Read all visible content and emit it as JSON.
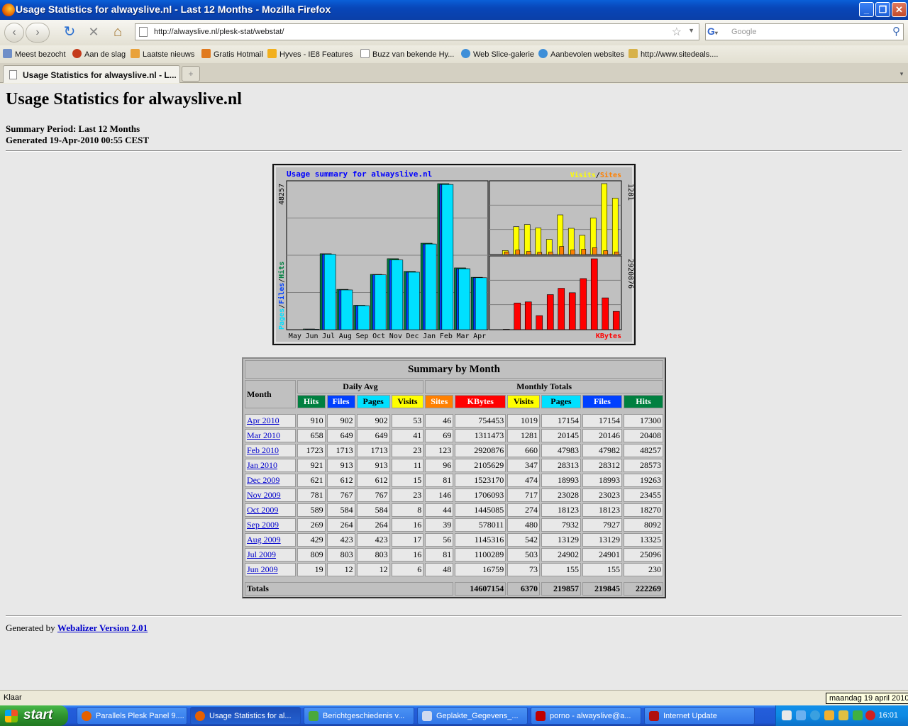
{
  "window": {
    "title": "Usage Statistics for alwayslive.nl - Last 12 Months - Mozilla Firefox",
    "min": "_",
    "max": "❐",
    "close": "✕"
  },
  "nav": {
    "url": "http://alwayslive.nl/plesk-stat/webstat/",
    "search_placeholder": "Google",
    "back": "‹",
    "forward": "›",
    "reload": "↻",
    "stop": "✕",
    "home": "⌂"
  },
  "bookmarks": [
    {
      "label": "Meest bezocht",
      "icon": "folder-icon",
      "color": "#6f8fc8"
    },
    {
      "label": "Aan de slag",
      "icon": "firefox-icon",
      "color": "#c43b1c"
    },
    {
      "label": "Laatste nieuws",
      "icon": "rss-icon",
      "color": "#e9a23a"
    },
    {
      "label": "Gratis Hotmail",
      "icon": "msn-icon",
      "color": "#e07a1f"
    },
    {
      "label": "Hyves - IE8 Features",
      "icon": "hyves-icon",
      "color": "#f2b01e"
    },
    {
      "label": "Buzz van bekende Hy...",
      "icon": "page-icon",
      "color": "#ffffff"
    },
    {
      "label": "Web Slice-galerie",
      "icon": "ie-icon",
      "color": "#3e8fd8"
    },
    {
      "label": "Aanbevolen websites",
      "icon": "ie-icon",
      "color": "#3e8fd8"
    },
    {
      "label": "http://www.sitedeals....",
      "icon": "sd-icon",
      "color": "#d7b24a"
    }
  ],
  "tab": {
    "label": "Usage Statistics for alwayslive.nl - L...",
    "new_tab": "+",
    "list": "▾"
  },
  "page": {
    "title": "Usage Statistics for alwayslive.nl",
    "summary_period": "Summary Period: Last 12 Months",
    "generated": "Generated 19-Apr-2010 00:55 CEST",
    "footer_prefix": "Generated by ",
    "footer_link": "Webalizer Version 2.01"
  },
  "chart_data": {
    "type": "bar",
    "title": "Usage summary for alwayslive.nl",
    "categories": [
      "May",
      "Jun",
      "Jul",
      "Aug",
      "Sep",
      "Oct",
      "Nov",
      "Dec",
      "Jan",
      "Feb",
      "Mar",
      "Apr"
    ],
    "left_panel": {
      "max_label": "48257",
      "ylabel_parts": [
        "Pages",
        "Files",
        "Hits"
      ],
      "series": [
        {
          "name": "Hits",
          "color": "#008040",
          "values": [
            0,
            230,
            25096,
            13325,
            8092,
            18270,
            23455,
            19263,
            28573,
            48257,
            20408,
            17300
          ]
        },
        {
          "name": "Files",
          "color": "#0040ff",
          "values": [
            0,
            155,
            24901,
            13129,
            7927,
            18123,
            23023,
            18993,
            28312,
            47982,
            20146,
            17154
          ]
        },
        {
          "name": "Pages",
          "color": "#00e0ff",
          "values": [
            0,
            155,
            24902,
            13129,
            7932,
            18123,
            23028,
            18993,
            28313,
            47983,
            20145,
            17154
          ]
        }
      ]
    },
    "top_right_panel": {
      "max_label": "1281",
      "legend_parts": [
        "Visits",
        "Sites"
      ],
      "series": [
        {
          "name": "Visits",
          "color": "#ffff00",
          "values": [
            0,
            73,
            503,
            542,
            480,
            274,
            717,
            474,
            347,
            660,
            1281,
            1019
          ]
        },
        {
          "name": "Sites",
          "color": "#ff8000",
          "values": [
            0,
            48,
            81,
            56,
            39,
            44,
            146,
            81,
            96,
            123,
            69,
            46
          ]
        }
      ]
    },
    "bottom_right_panel": {
      "max_label": "2920876",
      "legend": "KBytes",
      "series": [
        {
          "name": "KBytes",
          "color": "#ff0000",
          "values": [
            0,
            16759,
            1100289,
            1145316,
            578011,
            1445085,
            1706093,
            1523170,
            2105629,
            2920876,
            1311473,
            754453
          ]
        }
      ]
    }
  },
  "table": {
    "caption": "Summary by Month",
    "month_header": "Month",
    "daily_avg_header": "Daily Avg",
    "monthly_totals_header": "Monthly Totals",
    "columns": [
      {
        "label": "Hits",
        "color": "#008040",
        "text": "#ffffff"
      },
      {
        "label": "Files",
        "color": "#0040ff",
        "text": "#ffffff"
      },
      {
        "label": "Pages",
        "color": "#00e0ff",
        "text": "#000000"
      },
      {
        "label": "Visits",
        "color": "#ffff00",
        "text": "#000000"
      },
      {
        "label": "Sites",
        "color": "#ff8000",
        "text": "#ffffff"
      },
      {
        "label": "KBytes",
        "color": "#ff0000",
        "text": "#ffffff"
      },
      {
        "label": "Visits",
        "color": "#ffff00",
        "text": "#000000"
      },
      {
        "label": "Pages",
        "color": "#00e0ff",
        "text": "#000000"
      },
      {
        "label": "Files",
        "color": "#0040ff",
        "text": "#ffffff"
      },
      {
        "label": "Hits",
        "color": "#008040",
        "text": "#ffffff"
      }
    ],
    "rows": [
      [
        "Apr 2010",
        "910",
        "902",
        "902",
        "53",
        "46",
        "754453",
        "1019",
        "17154",
        "17154",
        "17300"
      ],
      [
        "Mar 2010",
        "658",
        "649",
        "649",
        "41",
        "69",
        "1311473",
        "1281",
        "20145",
        "20146",
        "20408"
      ],
      [
        "Feb 2010",
        "1723",
        "1713",
        "1713",
        "23",
        "123",
        "2920876",
        "660",
        "47983",
        "47982",
        "48257"
      ],
      [
        "Jan 2010",
        "921",
        "913",
        "913",
        "11",
        "96",
        "2105629",
        "347",
        "28313",
        "28312",
        "28573"
      ],
      [
        "Dec 2009",
        "621",
        "612",
        "612",
        "15",
        "81",
        "1523170",
        "474",
        "18993",
        "18993",
        "19263"
      ],
      [
        "Nov 2009",
        "781",
        "767",
        "767",
        "23",
        "146",
        "1706093",
        "717",
        "23028",
        "23023",
        "23455"
      ],
      [
        "Oct 2009",
        "589",
        "584",
        "584",
        "8",
        "44",
        "1445085",
        "274",
        "18123",
        "18123",
        "18270"
      ],
      [
        "Sep 2009",
        "269",
        "264",
        "264",
        "16",
        "39",
        "578011",
        "480",
        "7932",
        "7927",
        "8092"
      ],
      [
        "Aug 2009",
        "429",
        "423",
        "423",
        "17",
        "56",
        "1145316",
        "542",
        "13129",
        "13129",
        "13325"
      ],
      [
        "Jul 2009",
        "809",
        "803",
        "803",
        "16",
        "81",
        "1100289",
        "503",
        "24902",
        "24901",
        "25096"
      ],
      [
        "Jun 2009",
        "19",
        "12",
        "12",
        "6",
        "48",
        "16759",
        "73",
        "155",
        "155",
        "230"
      ]
    ],
    "totals": {
      "label": "Totals",
      "values": [
        "14607154",
        "6370",
        "219857",
        "219845",
        "222269"
      ]
    }
  },
  "statusbar": {
    "text": "Klaar",
    "tooltip": "maandag 19 april 2010"
  },
  "taskbar": {
    "start": "start",
    "tasks": [
      {
        "label": "Parallels Plesk Panel 9....",
        "icon": "firefox-icon",
        "color": "#e66000"
      },
      {
        "label": "Usage Statistics for al...",
        "icon": "firefox-icon",
        "color": "#e66000"
      },
      {
        "label": "Berichtgeschiedenis v...",
        "icon": "msn-icon",
        "color": "#4aa83a"
      },
      {
        "label": "Geplakte_Gegevens_...",
        "icon": "document-icon",
        "color": "#cfd9ef"
      },
      {
        "label": "porno - alwayslive@a...",
        "icon": "filezilla-icon",
        "color": "#bf0000"
      },
      {
        "label": "Internet Update",
        "icon": "update-icon",
        "color": "#b01010"
      }
    ],
    "clock": "16:01"
  }
}
